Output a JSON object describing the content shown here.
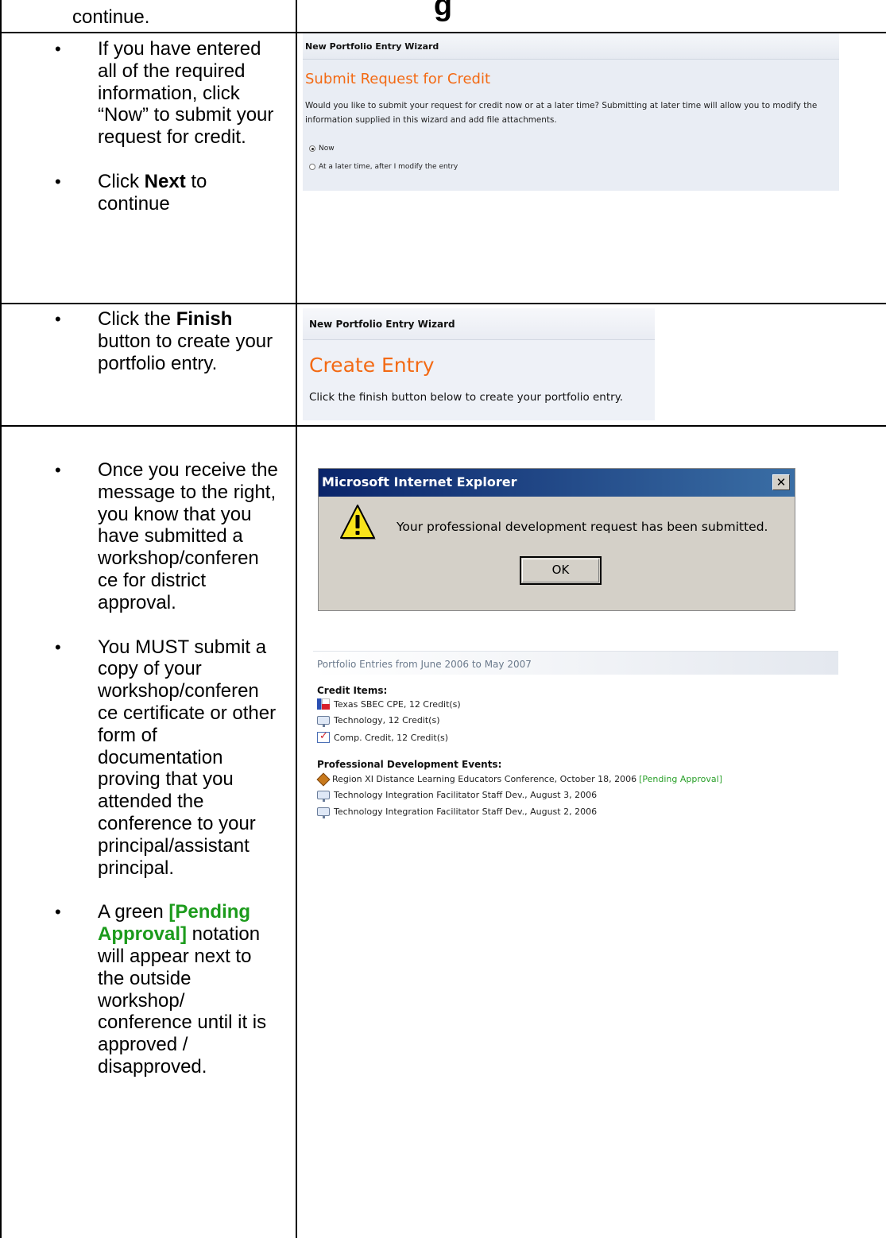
{
  "page_title_fragment": "g",
  "left_column": {
    "row1_tail": "continue.",
    "row2_bullets": [
      "If you have entered all of the required information, click “Now” to submit your request for credit.",
      {
        "before": "Click ",
        "bold": "Next",
        "after": " to continue"
      }
    ],
    "row3_bullet": {
      "before": "Click the ",
      "bold": "Finish",
      "after": " button to create your portfolio entry."
    },
    "row4_bullets": [
      "Once you receive the message to the right, you know that you have submitted a workshop/conferen ce for district approval.",
      "You MUST submit a copy of your workshop/conferen ce certificate or other form of documentation proving that you attended the conference to your principal/assistant principal.",
      {
        "before": "A green ",
        "green": "[Pending Approval]",
        "after": " notation will appear next to the outside workshop/ conference until it is approved / disapproved."
      }
    ]
  },
  "wizard_submit": {
    "header": "New Portfolio Entry Wizard",
    "title": "Submit Request for Credit",
    "description": "Would you like to submit your request for credit now or at a later time? Submitting at later time will allow you to modify the information supplied in this wizard and add file attachments.",
    "options": [
      {
        "label": "Now",
        "selected": true
      },
      {
        "label": "At a later time, after I modify the entry",
        "selected": false
      }
    ]
  },
  "wizard_create": {
    "header": "New Portfolio Entry Wizard",
    "title": "Create Entry",
    "description": "Click the finish button below to create your portfolio entry."
  },
  "dialog": {
    "title": "Microsoft Internet Explorer",
    "close_symbol": "✕",
    "message": "Your professional development request has been submitted.",
    "ok_label": "OK",
    "icon": "warning-icon"
  },
  "portfolio": {
    "header": "Portfolio Entries from June 2006 to May 2007",
    "credit_heading": "Credit Items:",
    "credit_items": [
      {
        "icon": "texas-flag-icon",
        "text": "Texas SBEC CPE, 12 Credit(s)"
      },
      {
        "icon": "computer-icon",
        "text": "Technology, 12 Credit(s)"
      },
      {
        "icon": "checkbox-icon",
        "text": "Comp. Credit, 12 Credit(s)"
      }
    ],
    "events_heading": "Professional Development Events:",
    "events": [
      {
        "icon": "diamond-icon",
        "text": "Region XI Distance Learning Educators Conference, October 18, 2006",
        "status": "[Pending Approval]"
      },
      {
        "icon": "computer-icon",
        "text": "Technology Integration Facilitator Staff Dev., August 3, 2006",
        "status": ""
      },
      {
        "icon": "computer-icon",
        "text": "Technology Integration Facilitator Staff Dev., August 2, 2006",
        "status": ""
      }
    ],
    "status_color": "#2aa02a"
  }
}
